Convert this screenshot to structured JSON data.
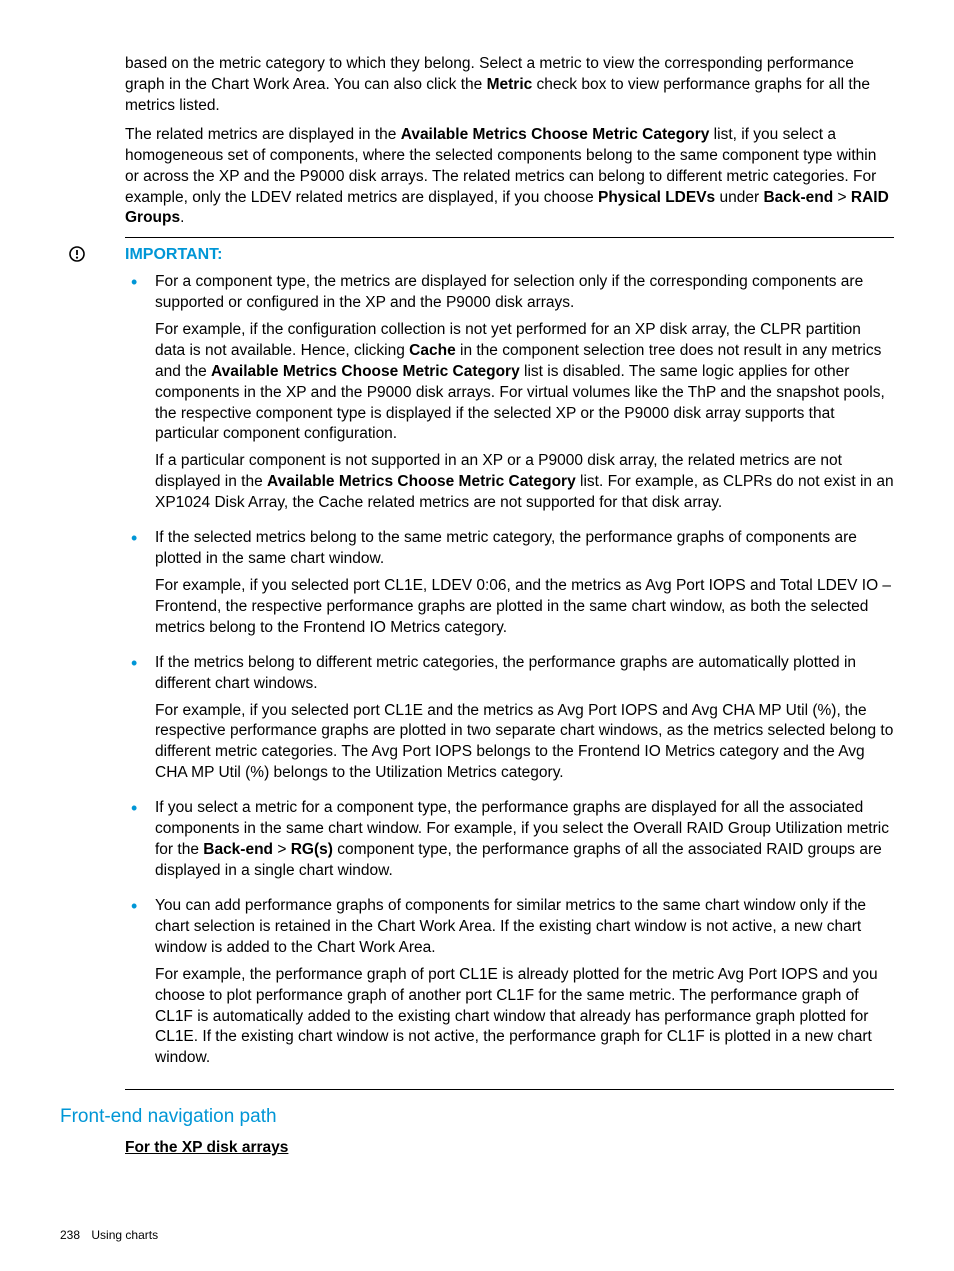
{
  "intro": {
    "p1a": "based on the metric category to which they belong. Select a metric to view the corresponding performance graph in the Chart Work Area. You can also click the ",
    "p1b": "Metric",
    "p1c": " check box to view performance graphs for all the metrics listed.",
    "p2a": "The related metrics are displayed in the ",
    "p2b": "Available Metrics Choose Metric Category",
    "p2c": " list, if you select a homogeneous set of components, where the selected components belong to the same component type within or across the XP and the P9000 disk arrays. The related metrics can belong to different metric categories. For example, only the LDEV related metrics are displayed, if you choose ",
    "p2d": "Physical LDEVs",
    "p2e": " under ",
    "p2f": "Back-end",
    "p2g": " > ",
    "p2h": "RAID Groups",
    "p2i": "."
  },
  "important_label": "IMPORTANT:",
  "bullets": {
    "b1": {
      "p1": "For a component type, the metrics are displayed for selection only if the corresponding components are supported or configured in the XP and the P9000 disk arrays.",
      "p2a": "For example, if the configuration collection is not yet performed for an XP disk array, the CLPR partition data is not available. Hence, clicking ",
      "p2b": "Cache",
      "p2c": " in the component selection tree does not result in any metrics and the ",
      "p2d": "Available Metrics Choose Metric Category",
      "p2e": " list is disabled. The same logic applies for other components in the XP and the P9000 disk arrays. For virtual volumes like the ThP and the snapshot pools, the respective component type is displayed if the selected XP or the P9000 disk array supports that particular component configuration.",
      "p3a": "If a particular component is not supported in an XP or a P9000 disk array, the related metrics are not displayed in the ",
      "p3b": "Available Metrics Choose Metric Category",
      "p3c": " list. For example, as CLPRs do not exist in an XP1024 Disk Array, the Cache related metrics are not supported for that disk array."
    },
    "b2": {
      "p1": "If the selected metrics belong to the same metric category, the performance graphs of components are plotted in the same chart window.",
      "p2": "For example, if you selected port CL1E, LDEV 0:06, and the metrics as Avg Port IOPS and Total LDEV IO – Frontend, the respective performance graphs are plotted in the same chart window, as both the selected metrics belong to the Frontend IO Metrics category."
    },
    "b3": {
      "p1": "If the metrics belong to different metric categories, the performance graphs are automatically plotted in different chart windows.",
      "p2": "For example, if you selected port CL1E and the metrics as Avg Port IOPS and Avg CHA MP Util (%), the respective performance graphs are plotted in two separate chart windows, as the metrics selected belong to different metric categories. The Avg Port IOPS belongs to the Frontend IO Metrics category and the Avg CHA MP Util (%) belongs to the Utilization Metrics category."
    },
    "b4": {
      "p1a": "If you select a metric for a component type, the performance graphs are displayed for all the associated components in the same chart window. For example, if you select the Overall RAID Group Utilization metric for the ",
      "p1b": "Back-end",
      "p1c": " > ",
      "p1d": "RG(s)",
      "p1e": " component type, the performance graphs of all the associated RAID groups are displayed in a single chart window."
    },
    "b5": {
      "p1": "You can add performance graphs of components for similar metrics to the same chart window only if the chart selection is retained in the Chart Work Area. If the existing chart window is not active, a new chart window is added to the Chart Work Area.",
      "p2": "For example, the performance graph of port CL1E is already plotted for the metric Avg Port IOPS and you choose to plot performance graph of another port CL1F for the same metric. The performance graph of CL1F is automatically added to the existing chart window that already has performance graph plotted for CL1E. If the existing chart window is not active, the performance graph for CL1F is plotted in a new chart window."
    }
  },
  "section_heading": "Front-end navigation path",
  "sub_heading": "For the XP disk arrays",
  "footer": {
    "page": "238",
    "title": "Using charts"
  }
}
